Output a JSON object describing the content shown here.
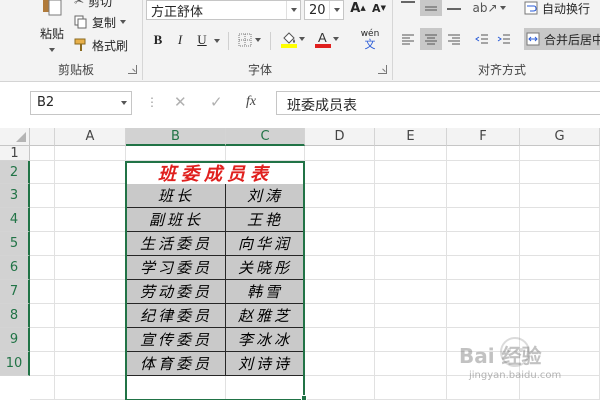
{
  "ribbon": {
    "clipboard": {
      "paste_label": "粘贴",
      "cut_label": "剪切",
      "copy_label": "复制",
      "format_painter_label": "格式刷",
      "group_label": "剪贴板"
    },
    "font": {
      "font_name": "方正舒体",
      "font_size": "20",
      "bold_label": "B",
      "italic_label": "I",
      "underline_label": "U",
      "phonetic_label": "wén",
      "phonetic_sub": "文",
      "group_label": "字体",
      "highlight_color": "#ffff00",
      "font_color": "#e0201e"
    },
    "alignment": {
      "wrap_text_label": "自动换行",
      "merge_center_label": "合并后居中",
      "group_label": "对齐方式"
    }
  },
  "formula_bar": {
    "name_box": "B2",
    "fx_label": "fx",
    "formula": "班委成员表"
  },
  "columns": [
    "A",
    "B",
    "C",
    "D",
    "E",
    "F",
    "G"
  ],
  "rows": [
    "1",
    "2",
    "3",
    "4",
    "5",
    "6",
    "7",
    "8",
    "9",
    "10"
  ],
  "table": {
    "title": "班委成员表",
    "rows": [
      [
        "班长",
        "刘涛"
      ],
      [
        "副班长",
        "王艳"
      ],
      [
        "生活委员",
        "向华润"
      ],
      [
        "学习委员",
        "关晓彤"
      ],
      [
        "劳动委员",
        "韩雪"
      ],
      [
        "纪律委员",
        "赵雅芝"
      ],
      [
        "宣传委员",
        "李冰冰"
      ],
      [
        "体育委员",
        "刘诗诗"
      ]
    ]
  },
  "watermark": {
    "text": "Bai 经验",
    "url": "jingyan.baidu.com"
  },
  "colors": {
    "accent": "#217346",
    "table_fill": "#c9c9c9",
    "title_text": "#e0201e"
  }
}
